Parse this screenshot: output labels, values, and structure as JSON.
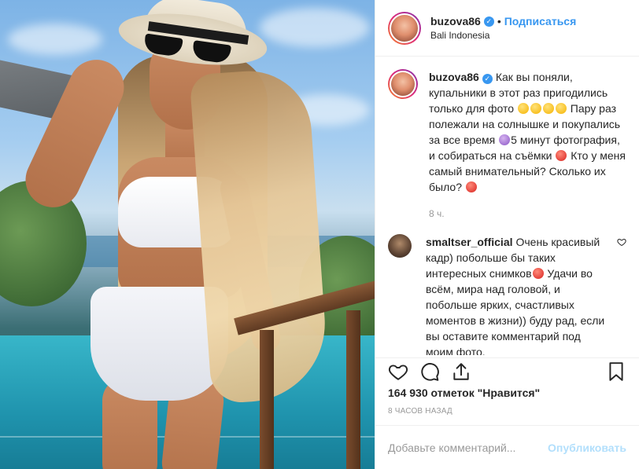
{
  "post": {
    "author": {
      "username": "buzova86",
      "verified_icon": "verified-badge-icon",
      "follow_label": "Подписаться",
      "separator": "•",
      "location": "Bali Indonesia"
    },
    "caption": {
      "username": "buzova86",
      "text_1": "Как вы поняли, купальники в этот раз пригодились только для фото",
      "text_2": "Пару раз полежали на солнышке и покупались за все время",
      "text_3": "5 минут фотография, и собираться на съёмки",
      "text_4": "Кто у меня самый внимательный? Сколько их было?",
      "time": "8 ч."
    },
    "comment": {
      "username": "smaltser_official",
      "text_1": "Очень красивый кадр) побольше бы таких интересных снимков",
      "text_2": "Удачи во всём, мира над головой, и побольше ярких, счастливых моментов в жизни)) буду рад, если вы оставите комментарий под моим фото.",
      "like_icon": "heart-outline-icon"
    },
    "actions": {
      "like_icon": "heart-outline-icon",
      "comment_icon": "comment-bubble-icon",
      "share_icon": "share-arrow-icon",
      "save_icon": "bookmark-icon"
    },
    "likes_text": "164 930 отметок \"Нравится\"",
    "posted_ago": "8 часов назад",
    "add_comment": {
      "placeholder": "Добавьте комментарий...",
      "publish_label": "Опубликовать"
    }
  },
  "colors": {
    "link_blue": "#3897f0",
    "publish_disabled": "#b2dffc",
    "muted": "#999999",
    "text": "#262626"
  }
}
